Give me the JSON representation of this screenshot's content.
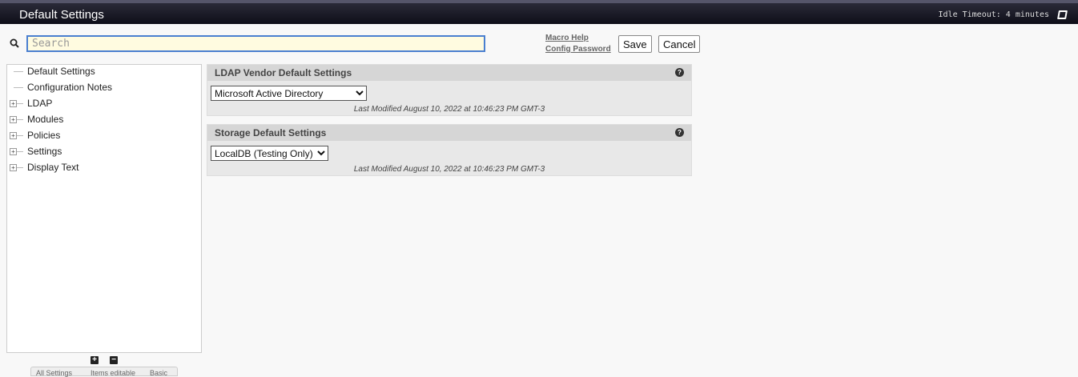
{
  "header": {
    "title": "Default Settings",
    "idle_timeout": "Idle Timeout: 4 minutes"
  },
  "search": {
    "placeholder": "Search",
    "value": ""
  },
  "links": {
    "macro_help": "Macro Help",
    "config_password": "Config Password"
  },
  "buttons": {
    "save": "Save",
    "cancel": "Cancel"
  },
  "tree": {
    "items": [
      {
        "label": "Default Settings",
        "expandable": false
      },
      {
        "label": "Configuration Notes",
        "expandable": false
      },
      {
        "label": "LDAP",
        "expandable": true
      },
      {
        "label": "Modules",
        "expandable": true
      },
      {
        "label": "Policies",
        "expandable": true
      },
      {
        "label": "Settings",
        "expandable": true
      },
      {
        "label": "Display Text",
        "expandable": true
      }
    ]
  },
  "tree_tools": {
    "expand": "+",
    "collapse": "−"
  },
  "bottom_tabs": [
    "All Settings",
    "Items editable",
    "Basic"
  ],
  "panels": [
    {
      "title": "LDAP Vendor Default Settings",
      "selected": "Microsoft Active Directory",
      "modified": "Last Modified August 10, 2022 at 10:46:23 PM GMT-3"
    },
    {
      "title": "Storage Default Settings",
      "selected": "LocalDB (Testing Only)",
      "modified": "Last Modified August 10, 2022 at 10:46:23 PM GMT-3"
    }
  ]
}
